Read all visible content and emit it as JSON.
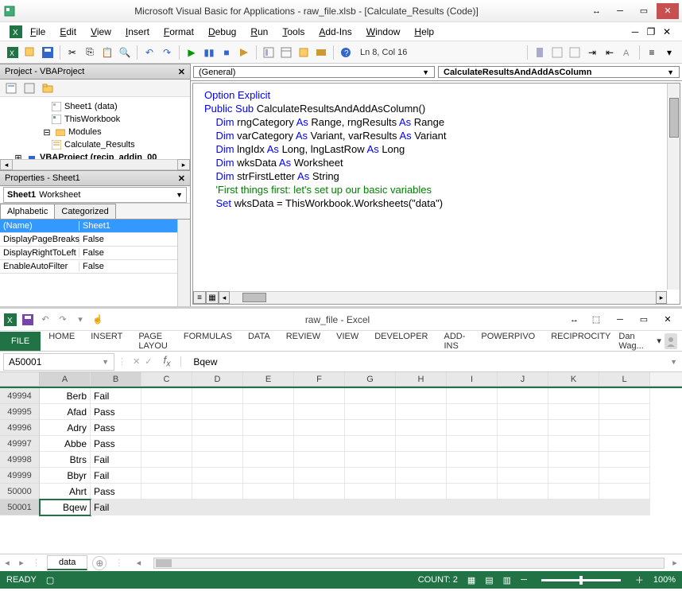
{
  "vba": {
    "title": "Microsoft Visual Basic for Applications - raw_file.xlsb - [Calculate_Results (Code)]",
    "menus": [
      "File",
      "Edit",
      "View",
      "Insert",
      "Format",
      "Debug",
      "Run",
      "Tools",
      "Add-Ins",
      "Window",
      "Help"
    ],
    "cursor_status": "Ln 8, Col 16",
    "project_title": "Project - VBAProject",
    "tree": {
      "sheet": "Sheet1 (data)",
      "twk": "ThisWorkbook",
      "modules": "Modules",
      "mod1": "Calculate_Results",
      "proj2": "VBAProject (recip_addin_00"
    },
    "properties_title": "Properties - Sheet1",
    "prop_object": "Sheet1 Worksheet",
    "tab_alpha": "Alphabetic",
    "tab_cat": "Categorized",
    "props": [
      {
        "name": "(Name)",
        "val": "Sheet1",
        "sel": true
      },
      {
        "name": "DisplayPageBreaks",
        "val": "False"
      },
      {
        "name": "DisplayRightToLeft",
        "val": "False"
      },
      {
        "name": "EnableAutoFilter",
        "val": "False"
      }
    ],
    "dd_left": "(General)",
    "dd_right": "CalculateResultsAndAddAsColumn",
    "code": [
      {
        "segs": [
          {
            "t": "Option ",
            "c": "kw"
          },
          {
            "t": "Explicit",
            "c": "kw"
          }
        ]
      },
      {
        "segs": [
          {
            "t": "Public Sub ",
            "c": "kw"
          },
          {
            "t": "CalculateResultsAndAddAsColumn()"
          }
        ]
      },
      {
        "segs": [
          {
            "t": ""
          }
        ]
      },
      {
        "segs": [
          {
            "t": "    "
          },
          {
            "t": "Dim ",
            "c": "kw"
          },
          {
            "t": "rngCategory "
          },
          {
            "t": "As ",
            "c": "kw"
          },
          {
            "t": "Range, rngResults "
          },
          {
            "t": "As ",
            "c": "kw"
          },
          {
            "t": "Range"
          }
        ]
      },
      {
        "segs": [
          {
            "t": "    "
          },
          {
            "t": "Dim ",
            "c": "kw"
          },
          {
            "t": "varCategory "
          },
          {
            "t": "As ",
            "c": "kw"
          },
          {
            "t": "Variant, varResults "
          },
          {
            "t": "As ",
            "c": "kw"
          },
          {
            "t": "Variant"
          }
        ]
      },
      {
        "segs": [
          {
            "t": "    "
          },
          {
            "t": "Dim ",
            "c": "kw"
          },
          {
            "t": "lngIdx "
          },
          {
            "t": "As ",
            "c": "kw"
          },
          {
            "t": "Long, lngLastRow "
          },
          {
            "t": "As ",
            "c": "kw"
          },
          {
            "t": "Long"
          }
        ]
      },
      {
        "segs": [
          {
            "t": "    "
          },
          {
            "t": "Dim ",
            "c": "kw"
          },
          {
            "t": "wksData "
          },
          {
            "t": "As ",
            "c": "kw"
          },
          {
            "t": "Worksheet"
          }
        ]
      },
      {
        "segs": [
          {
            "t": "    "
          },
          {
            "t": "Dim ",
            "c": "kw"
          },
          {
            "t": "strFirstLetter "
          },
          {
            "t": "As ",
            "c": "kw"
          },
          {
            "t": "String"
          }
        ]
      },
      {
        "segs": [
          {
            "t": ""
          }
        ]
      },
      {
        "segs": [
          {
            "t": "    "
          },
          {
            "t": "'First things first: let's set up our basic variables",
            "c": "cm"
          }
        ]
      },
      {
        "segs": [
          {
            "t": "    "
          },
          {
            "t": "Set ",
            "c": "kw"
          },
          {
            "t": "wksData = ThisWorkbook.Worksheets(\"data\")"
          }
        ]
      }
    ]
  },
  "excel": {
    "title": "raw_file - Excel",
    "ribbon": {
      "file": "FILE",
      "tabs": [
        "HOME",
        "INSERT",
        "PAGE LAYOU",
        "FORMULAS",
        "DATA",
        "REVIEW",
        "VIEW",
        "DEVELOPER",
        "ADD-INS",
        "POWERPIVO",
        "RECIPROCITY"
      ]
    },
    "user": "Dan Wag...",
    "namebox": "A50001",
    "formula": "Bqew",
    "cols": [
      "A",
      "B",
      "C",
      "D",
      "E",
      "F",
      "G",
      "H",
      "I",
      "J",
      "K",
      "L"
    ],
    "rows": [
      {
        "n": "49994",
        "a": "Berb",
        "b": "Fail"
      },
      {
        "n": "49995",
        "a": "Afad",
        "b": "Pass"
      },
      {
        "n": "49996",
        "a": "Adry",
        "b": "Pass"
      },
      {
        "n": "49997",
        "a": "Abbe",
        "b": "Pass"
      },
      {
        "n": "49998",
        "a": "Btrs",
        "b": "Fail"
      },
      {
        "n": "49999",
        "a": "Bbyr",
        "b": "Fail"
      },
      {
        "n": "50000",
        "a": "Ahrt",
        "b": "Pass"
      },
      {
        "n": "50001",
        "a": "Bqew",
        "b": "Fail",
        "sel": true
      }
    ],
    "sheet_tab": "data",
    "status_ready": "READY",
    "count": "COUNT: 2",
    "zoom": "100%"
  }
}
